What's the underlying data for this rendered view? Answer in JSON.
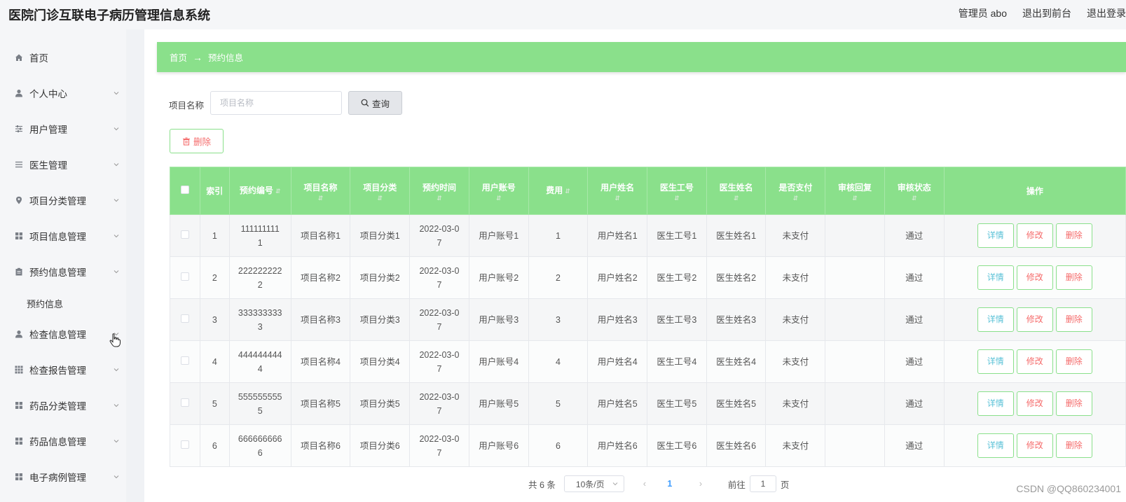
{
  "header": {
    "title": "医院门诊互联电子病历管理信息系统",
    "admin": "管理员 abo",
    "to_front": "退出到前台",
    "logout": "退出登录"
  },
  "sidebar": {
    "items": [
      {
        "label": "首页",
        "icon": "home-icon"
      },
      {
        "label": "个人中心",
        "icon": "user-icon"
      },
      {
        "label": "用户管理",
        "icon": "sliders-icon"
      },
      {
        "label": "医生管理",
        "icon": "list-icon"
      },
      {
        "label": "项目分类管理",
        "icon": "location-icon"
      },
      {
        "label": "项目信息管理",
        "icon": "grid-icon"
      },
      {
        "label": "预约信息管理",
        "icon": "clipboard-icon"
      },
      {
        "label": "检查信息管理",
        "icon": "user-icon"
      },
      {
        "label": "检查报告管理",
        "icon": "apps-icon"
      },
      {
        "label": "药品分类管理",
        "icon": "grid-icon"
      },
      {
        "label": "药品信息管理",
        "icon": "grid-icon"
      },
      {
        "label": "电子病例管理",
        "icon": "grid-icon"
      }
    ],
    "subitem": "预约信息"
  },
  "breadcrumb": {
    "home": "首页",
    "arrow": "→",
    "current": "预约信息"
  },
  "search": {
    "label": "项目名称",
    "placeholder": "项目名称",
    "button": "查询"
  },
  "toolbar": {
    "delete": "删除"
  },
  "table": {
    "columns": [
      "索引",
      "预约编号",
      "项目名称",
      "项目分类",
      "预约时间",
      "用户账号",
      "费用",
      "用户姓名",
      "医生工号",
      "医生姓名",
      "是否支付",
      "审核回复",
      "审核状态",
      "操作"
    ],
    "rows": [
      {
        "index": "1",
        "code_a": "111111111",
        "code_b": "1",
        "name": "项目名称1",
        "cat": "项目分类1",
        "time_a": "2022-03-0",
        "time_b": "7",
        "account": "用户账号1",
        "fee": "1",
        "uname": "用户姓名1",
        "docno": "医生工号1",
        "docname": "医生姓名1",
        "paid": "未支付",
        "reply": "",
        "status": "通过"
      },
      {
        "index": "2",
        "code_a": "222222222",
        "code_b": "2",
        "name": "项目名称2",
        "cat": "项目分类2",
        "time_a": "2022-03-0",
        "time_b": "7",
        "account": "用户账号2",
        "fee": "2",
        "uname": "用户姓名2",
        "docno": "医生工号2",
        "docname": "医生姓名2",
        "paid": "未支付",
        "reply": "",
        "status": "通过"
      },
      {
        "index": "3",
        "code_a": "333333333",
        "code_b": "3",
        "name": "项目名称3",
        "cat": "项目分类3",
        "time_a": "2022-03-0",
        "time_b": "7",
        "account": "用户账号3",
        "fee": "3",
        "uname": "用户姓名3",
        "docno": "医生工号3",
        "docname": "医生姓名3",
        "paid": "未支付",
        "reply": "",
        "status": "通过"
      },
      {
        "index": "4",
        "code_a": "444444444",
        "code_b": "4",
        "name": "项目名称4",
        "cat": "项目分类4",
        "time_a": "2022-03-0",
        "time_b": "7",
        "account": "用户账号4",
        "fee": "4",
        "uname": "用户姓名4",
        "docno": "医生工号4",
        "docname": "医生姓名4",
        "paid": "未支付",
        "reply": "",
        "status": "通过"
      },
      {
        "index": "5",
        "code_a": "555555555",
        "code_b": "5",
        "name": "项目名称5",
        "cat": "项目分类5",
        "time_a": "2022-03-0",
        "time_b": "7",
        "account": "用户账号5",
        "fee": "5",
        "uname": "用户姓名5",
        "docno": "医生工号5",
        "docname": "医生姓名5",
        "paid": "未支付",
        "reply": "",
        "status": "通过"
      },
      {
        "index": "6",
        "code_a": "666666666",
        "code_b": "6",
        "name": "项目名称6",
        "cat": "项目分类6",
        "time_a": "2022-03-0",
        "time_b": "7",
        "account": "用户账号6",
        "fee": "6",
        "uname": "用户姓名6",
        "docno": "医生工号6",
        "docname": "医生姓名6",
        "paid": "未支付",
        "reply": "",
        "status": "通过"
      }
    ],
    "actions": {
      "detail": "详情",
      "edit": "修改",
      "delete": "删除"
    }
  },
  "pagination": {
    "total": "共 6 条",
    "page_size": "10条/页",
    "prev": "‹",
    "current": "1",
    "next": "›",
    "goto": "前往",
    "goto_value": "1",
    "page_unit": "页"
  },
  "watermark": "CSDN @QQ860234001",
  "colors": {
    "accent": "#8ae08b",
    "danger": "#f56c6c",
    "info": "#5bc2d7"
  }
}
